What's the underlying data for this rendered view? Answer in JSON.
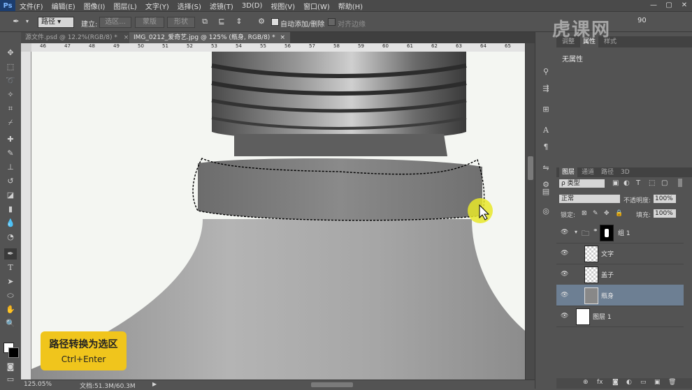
{
  "app": {
    "logo": "Ps"
  },
  "menu": [
    "文件(F)",
    "编辑(E)",
    "图像(I)",
    "图层(L)",
    "文字(Y)",
    "选择(S)",
    "滤镜(T)",
    "3D(D)",
    "视图(V)",
    "窗口(W)",
    "帮助(H)"
  ],
  "window_controls": [
    "—",
    "▢",
    "✕"
  ],
  "options": {
    "tool_mode": "路径",
    "make_label": "建立:",
    "selection_btn": "选区...",
    "mask_btn": "蒙版",
    "shape_btn": "形状",
    "auto_add_delete": "自动添加/删除",
    "align_edges": "对齐边缘",
    "search_value": "90"
  },
  "tabs": [
    {
      "label": "源文件.psd @ 12.2%(RGB/8) *",
      "close": "×"
    },
    {
      "label": "IMG_0212_爱奇艺.jpg @ 125% (瓶身, RGB/8) *",
      "close": "×"
    }
  ],
  "ruler": {
    "h_ticks": [
      "46",
      "47",
      "48",
      "49",
      "50",
      "51",
      "52",
      "53",
      "54",
      "55",
      "56",
      "57",
      "58",
      "59",
      "60",
      "61",
      "62",
      "63",
      "64",
      "65"
    ]
  },
  "status": {
    "zoom": "125.05%",
    "doc": "文档:51.3M/60.3M",
    "arrow": "▶"
  },
  "caption": {
    "title": "路径转换为选区",
    "shortcut": "Ctrl+Enter"
  },
  "properties": {
    "tabs": [
      "调整",
      "属性",
      "样式"
    ],
    "body": "无属性"
  },
  "layers_panel": {
    "tabs": [
      "图层",
      "通道",
      "路径",
      "3D"
    ],
    "filter_type": "ρ 类型",
    "blend_mode": "正常",
    "opacity_label": "不透明度:",
    "opacity_value": "100%",
    "lock_label": "锁定:",
    "fill_label": "填充:",
    "fill_value": "100%",
    "layers": [
      {
        "name": "组 1"
      },
      {
        "name": "文字"
      },
      {
        "name": "盖子"
      },
      {
        "name": "瓶身"
      },
      {
        "name": "图层 1"
      }
    ],
    "footer_icons": [
      "⊕",
      "fx",
      "◙",
      "◐",
      "▭",
      "▣",
      "🗑"
    ]
  },
  "watermark": "虎课网"
}
